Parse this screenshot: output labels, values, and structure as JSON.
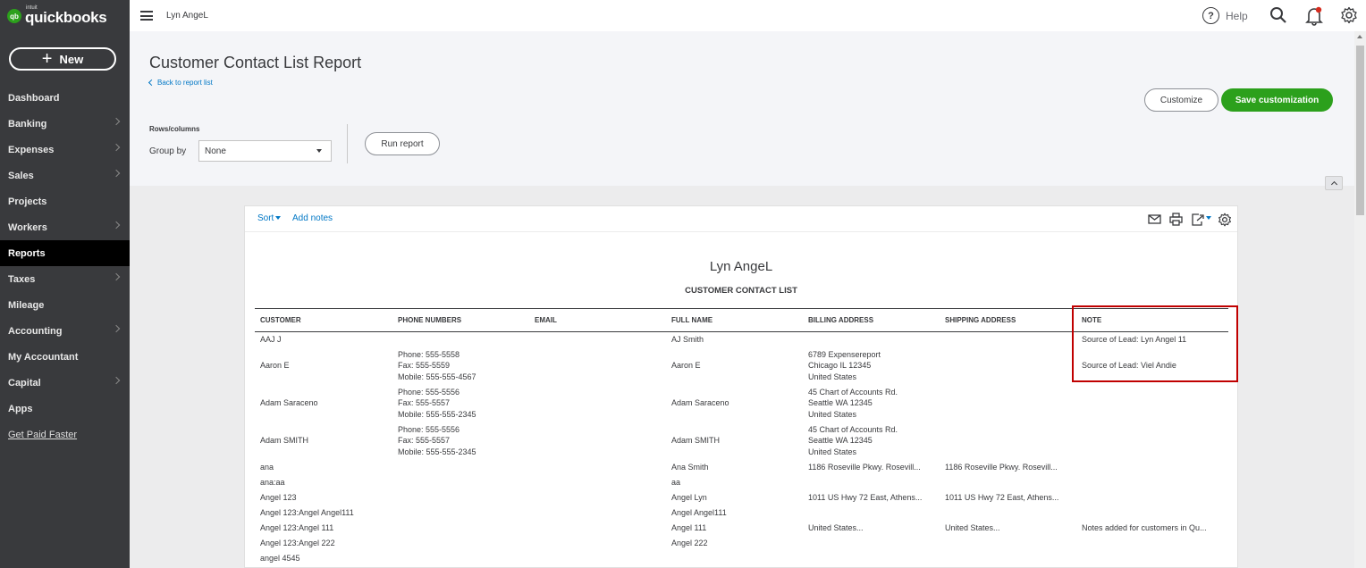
{
  "sidebar": {
    "logo": {
      "badge": "qb",
      "intuit": "intuit",
      "wordmark": "quickbooks"
    },
    "new_button": "New",
    "items": [
      {
        "label": "Dashboard",
        "chevron": false,
        "active": false
      },
      {
        "label": "Banking",
        "chevron": true,
        "active": false
      },
      {
        "label": "Expenses",
        "chevron": true,
        "active": false
      },
      {
        "label": "Sales",
        "chevron": true,
        "active": false
      },
      {
        "label": "Projects",
        "chevron": false,
        "active": false
      },
      {
        "label": "Workers",
        "chevron": true,
        "active": false
      },
      {
        "label": "Reports",
        "chevron": false,
        "active": true
      },
      {
        "label": "Taxes",
        "chevron": true,
        "active": false
      },
      {
        "label": "Mileage",
        "chevron": false,
        "active": false
      },
      {
        "label": "Accounting",
        "chevron": true,
        "active": false
      },
      {
        "label": "My Accountant",
        "chevron": false,
        "active": false
      },
      {
        "label": "Capital",
        "chevron": true,
        "active": false
      },
      {
        "label": "Apps",
        "chevron": false,
        "active": false
      }
    ],
    "get_paid": "Get Paid Faster"
  },
  "topbar": {
    "company": "Lyn AngeL",
    "help": "Help",
    "help_icon": "?"
  },
  "header": {
    "title": "Customer Contact List Report",
    "back_link": "Back to report list",
    "rows_columns": "Rows/columns",
    "group_by_label": "Group by",
    "group_by_value": "None",
    "run_report": "Run report",
    "customize": "Customize",
    "save_customization": "Save customization"
  },
  "report": {
    "sort": "Sort",
    "add_notes": "Add notes",
    "company": "Lyn AngeL",
    "title": "CUSTOMER CONTACT LIST",
    "columns": [
      "CUSTOMER",
      "PHONE NUMBERS",
      "EMAIL",
      "FULL NAME",
      "BILLING ADDRESS",
      "SHIPPING ADDRESS",
      "NOTE"
    ],
    "rows": [
      [
        "AAJ J",
        "",
        "",
        "AJ Smith",
        "",
        "",
        "Source of Lead: Lyn Angel 11"
      ],
      [
        "Aaron E",
        "Phone: 555-5558\nFax: 555-5559\nMobile: 555-555-4567",
        "",
        "Aaron E",
        "6789 Expensereport\nChicago IL 12345\nUnited States",
        "",
        "Source of Lead: Viel Andie"
      ],
      [
        "Adam Saraceno",
        "Phone: 555-5556\nFax: 555-5557\nMobile: 555-555-2345",
        "",
        "Adam Saraceno",
        "45 Chart of Accounts Rd.\nSeattle WA 12345\nUnited States",
        "",
        ""
      ],
      [
        "Adam SMITH",
        "Phone: 555-5556\nFax: 555-5557\nMobile: 555-555-2345",
        "",
        "Adam SMITH",
        "45 Chart of Accounts Rd.\nSeattle WA 12345\nUnited States",
        "",
        ""
      ],
      [
        "ana",
        "",
        "",
        "Ana Smith",
        "1186 Roseville Pkwy. Rosevill...",
        "1186 Roseville Pkwy. Rosevill...",
        ""
      ],
      [
        "ana:aa",
        "",
        "",
        "aa",
        "",
        "",
        ""
      ],
      [
        "Angel 123",
        "",
        "",
        "Angel Lyn",
        "1011 US Hwy 72 East, Athens...",
        "1011 US Hwy 72 East, Athens...",
        ""
      ],
      [
        "Angel 123:Angel Angel111",
        "",
        "",
        "Angel Angel111",
        "",
        "",
        ""
      ],
      [
        "Angel 123:Angel 111",
        "",
        "",
        "Angel 111",
        "United States...",
        "United States...",
        "Notes added for customers in Qu..."
      ],
      [
        "Angel 123:Angel 222",
        "",
        "",
        "Angel 222",
        "",
        "",
        ""
      ],
      [
        "angel 4545",
        "",
        "",
        "",
        "",
        "",
        ""
      ]
    ]
  },
  "colors": {
    "sidebar_bg": "#393a3d",
    "accent_green": "#2ca01c",
    "link_blue": "#0077c5",
    "highlight_red": "#c00000"
  }
}
